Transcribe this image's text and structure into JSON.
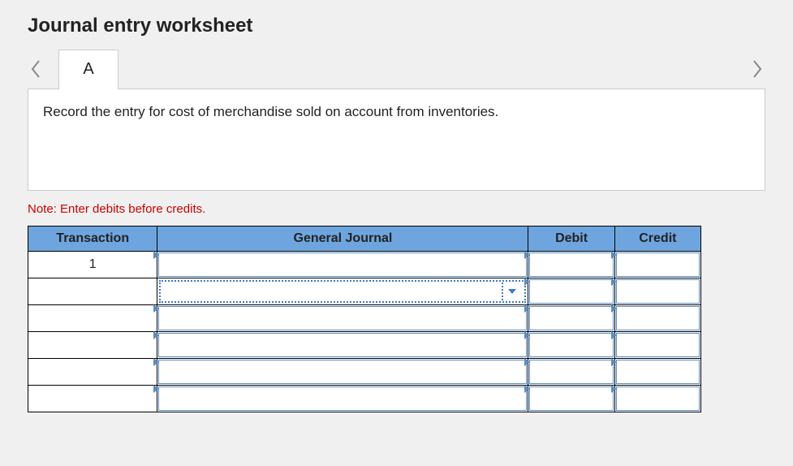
{
  "title": "Journal entry worksheet",
  "tab_label": "A",
  "instruction": "Record the entry for cost of merchandise sold on account from inventories.",
  "note": "Note: Enter debits before credits.",
  "columns": {
    "transaction": "Transaction",
    "general_journal": "General Journal",
    "debit": "Debit",
    "credit": "Credit"
  },
  "rows": [
    {
      "transaction": "1",
      "general_journal": "",
      "debit": "",
      "credit": "",
      "gj_active_dropdown": false
    },
    {
      "transaction": "",
      "general_journal": "",
      "debit": "",
      "credit": "",
      "gj_active_dropdown": true
    },
    {
      "transaction": "",
      "general_journal": "",
      "debit": "",
      "credit": "",
      "gj_active_dropdown": false
    },
    {
      "transaction": "",
      "general_journal": "",
      "debit": "",
      "credit": "",
      "gj_active_dropdown": false
    },
    {
      "transaction": "",
      "general_journal": "",
      "debit": "",
      "credit": "",
      "gj_active_dropdown": false
    },
    {
      "transaction": "",
      "general_journal": "",
      "debit": "",
      "credit": "",
      "gj_active_dropdown": false
    }
  ]
}
